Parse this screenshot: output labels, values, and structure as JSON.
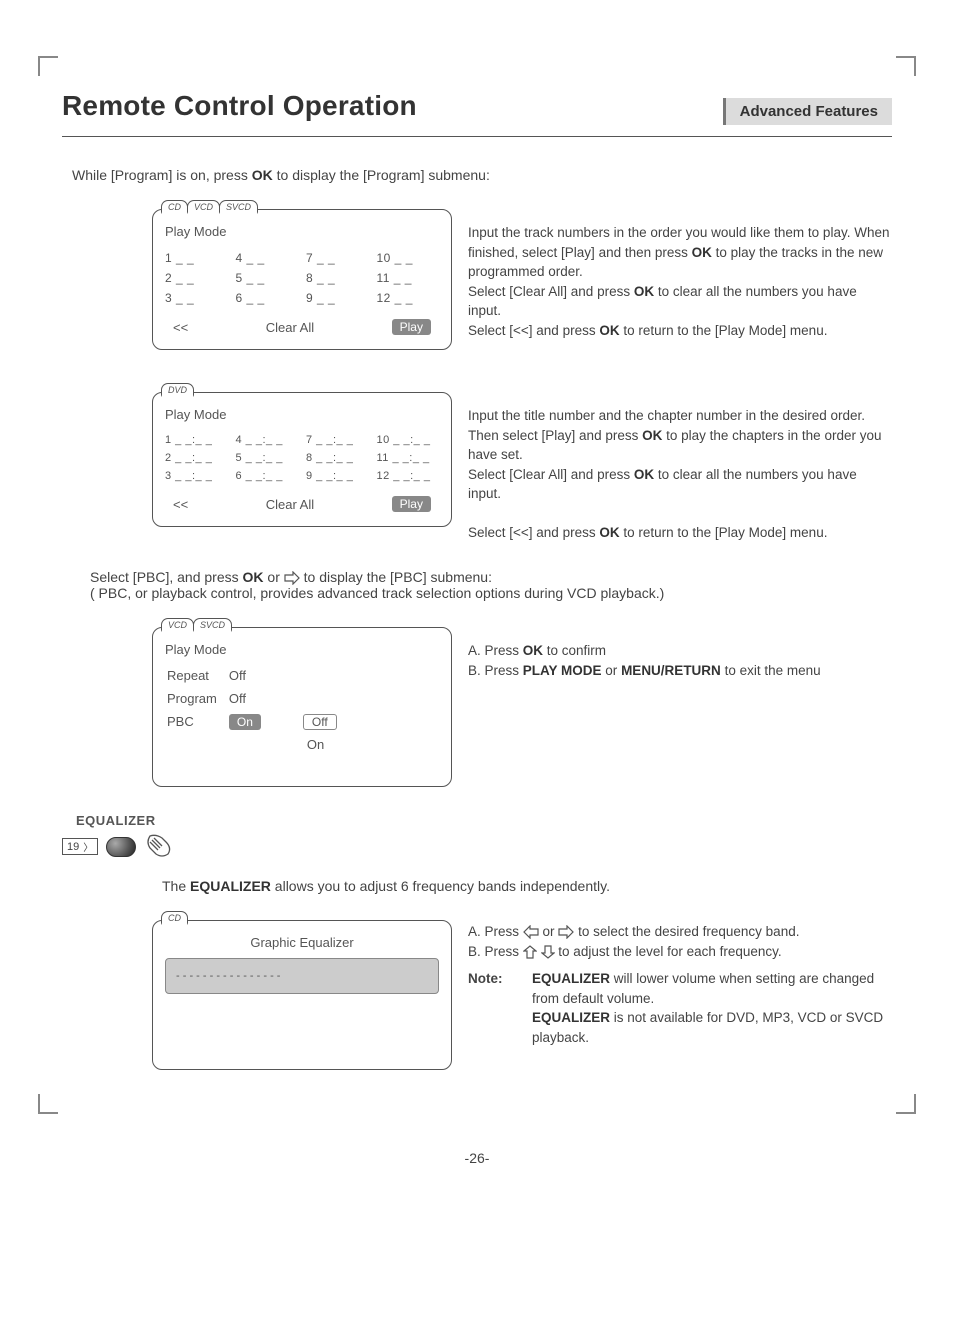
{
  "header": {
    "title": "Remote Control Operation",
    "subtitle": "Advanced Features"
  },
  "intro": {
    "pre": "While [Program] is on, press ",
    "bold": "OK",
    "post": " to display the [Program] submenu:"
  },
  "panel1": {
    "tabs": [
      "CD",
      "VCD",
      "SVCD"
    ],
    "heading": "Play Mode",
    "cells": [
      "1 _ _",
      "4 _ _",
      "7 _ _",
      "10 _ _",
      "2 _ _",
      "5 _ _",
      "8 _ _",
      "11 _ _",
      "3 _ _",
      "6 _ _",
      "9 _ _",
      "12 _ _"
    ],
    "back": "<<",
    "clear": "Clear All",
    "play": "Play"
  },
  "desc1": {
    "l1a": "Input the track numbers in the order you would like them to play. When finished, select [Play] and then press ",
    "l1b": "OK",
    "l1c": " to play the tracks in the new programmed order.",
    "l2a": "Select [Clear All] and press ",
    "l2b": "OK",
    "l2c": " to clear all the numbers you have input.",
    "l3a": "Select [<<] and press ",
    "l3b": "OK",
    "l3c": " to return to the [Play Mode] menu."
  },
  "panel2": {
    "tabs": [
      "DVD"
    ],
    "heading": "Play Mode",
    "cells": [
      "1 _ _:_ _",
      "4 _ _:_ _",
      "7 _ _:_ _",
      "10 _ _:_ _",
      "2 _ _:_ _",
      "5 _ _:_ _",
      "8 _ _:_ _",
      "11 _ _:_ _",
      "3 _ _:_ _",
      "6 _ _:_ _",
      "9 _ _:_ _",
      "12 _ _:_ _"
    ],
    "back": "<<",
    "clear": "Clear All",
    "play": "Play"
  },
  "desc2": {
    "l1a": "Input the title number and the chapter number in the desired order. Then select [Play] and press ",
    "l1b": "OK",
    "l1c": " to play the chapters in the order you have set.",
    "l2a": "Select [Clear All] and press ",
    "l2b": "OK",
    "l2c": " to clear all the numbers you have input.",
    "l3a": "Select [<<] and press ",
    "l3b": "OK",
    "l3c": " to return to the [Play Mode] menu."
  },
  "pbc_intro": {
    "l1a": "Select [PBC], and press ",
    "l1b": "OK",
    "l1c": " or ",
    "l1d": " to display the [PBC] submenu:",
    "l2": "( PBC, or playback control, provides advanced track selection options during VCD playback.)"
  },
  "panel3": {
    "tabs": [
      "VCD",
      "SVCD"
    ],
    "heading": "Play Mode",
    "rows": [
      {
        "label": "Repeat",
        "val": "Off"
      },
      {
        "label": "Program",
        "val": "Off"
      }
    ],
    "pbc_label": "PBC",
    "pbc_on": "On",
    "opt_off": "Off",
    "opt_on": "On"
  },
  "desc3": {
    "a_pre": "A.  Press ",
    "a_bold": "OK",
    "a_post": " to confirm",
    "b_pre": "B.  Press ",
    "b_bold1": "PLAY MODE",
    "b_mid": " or ",
    "b_bold2": "MENU/RETURN",
    "b_post": " to exit the menu"
  },
  "equalizer": {
    "heading": "EQUALIZER",
    "step_num": "19",
    "intro_pre": "The ",
    "intro_bold": "EQUALIZER",
    "intro_post": " allows you to adjust 6 frequency bands independently."
  },
  "panel4": {
    "tabs": [
      "CD"
    ],
    "title": "Graphic Equalizer",
    "bar": "- - - - - - - - - - - - - - - -"
  },
  "desc4": {
    "a_pre": "A.  Press ",
    "a_mid": " or ",
    "a_post": " to select the desired frequency band.",
    "b_pre": "B.  Press ",
    "b_post": " to adjust the level for each frequency.",
    "note_label": "Note:",
    "note1_bold": "EQUALIZER",
    "note1_post": " will lower volume when setting are changed from default volume.",
    "note2_bold": "EQUALIZER",
    "note2_post": " is not available for DVD, MP3, VCD or SVCD playback."
  },
  "footer": "-26-"
}
